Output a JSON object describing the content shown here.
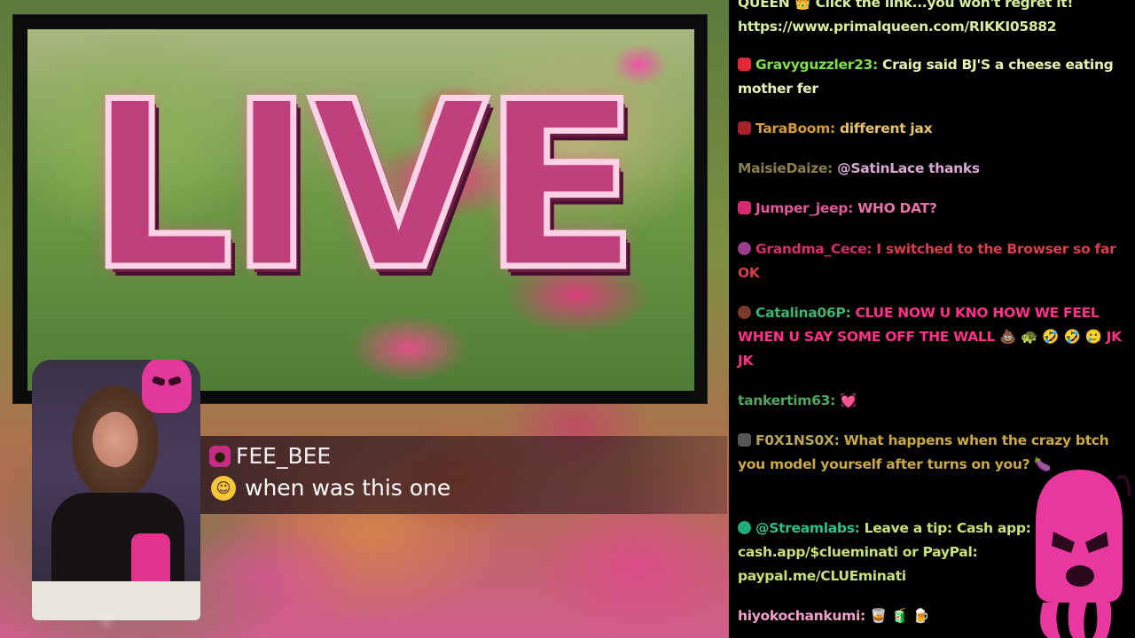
{
  "stream": {
    "live_text": "LIVE"
  },
  "highlight": {
    "username": "FEE_BEE",
    "message": "when was this one"
  },
  "chat": {
    "messages": [
      {
        "user": "",
        "user_color": "#ffffff",
        "text": "QUEEN 👑 Click the link...you won't regret it! https://www.primalqueen.com/RIKKI05882",
        "text_color": "#d9eda0"
      },
      {
        "user": "Gravyguzzler23:",
        "user_color": "#7fe04b",
        "text": " Craig said BJ'S a cheese eating mother fer",
        "text_color": "#e6f2b0"
      },
      {
        "user": "TaraBoom:",
        "user_color": "#d49a3a",
        "text": " different jax",
        "text_color": "#e9c46a"
      },
      {
        "user": "MaisieDaize:",
        "user_color": "#8a7d4e",
        "text": " @SatinLace thanks",
        "text_color": "#d7a9d6"
      },
      {
        "user": "Jumper_jeep:",
        "user_color": "#e0599a",
        "text": " WHO DAT?",
        "text_color": "#e86fa8"
      },
      {
        "user": "Grandma_Cece:",
        "user_color": "#d92b6a",
        "text": " I switched to the Browser so far OK",
        "text_color": "#dc3d4a"
      },
      {
        "user": "Catalina06P:",
        "user_color": "#3cb46e",
        "text": " CLUE NOW U KNO HOW WE FEEL WHEN U SAY SOME OFF THE WALL 💩 🐢 🤣 🤣 🥲 JK JK",
        "text_color": "#ff2f8a"
      },
      {
        "user": "tankertim63:",
        "user_color": "#4ea85a",
        "text": " 💓",
        "text_color": "#ff4f8a"
      },
      {
        "user": "F0X1NS0X:",
        "user_color": "#b7a55e",
        "text": " What happens when the crazy btch you model yourself after turns on you? 🍆",
        "text_color": "#caa845"
      },
      {
        "user": "@Streamlabs:",
        "user_color": "#2fc08a",
        "text": " Leave a tip: Cash app: cash.app/$clueminati or PayPal: paypal.me/CLUEminati",
        "text_color": "#c9e07a"
      },
      {
        "user": "hiyokochankumi:",
        "user_color": "#f1a0c8",
        "text": " 🥃 🧃 🍺",
        "text_color": "#ffe08a"
      }
    ]
  },
  "colors": {
    "accent": "#e3389b",
    "chat_bg": "#000000"
  },
  "icons": {
    "mascot": "pink-balaclava-octopus-icon",
    "mask": "pink-balaclava-icon"
  }
}
